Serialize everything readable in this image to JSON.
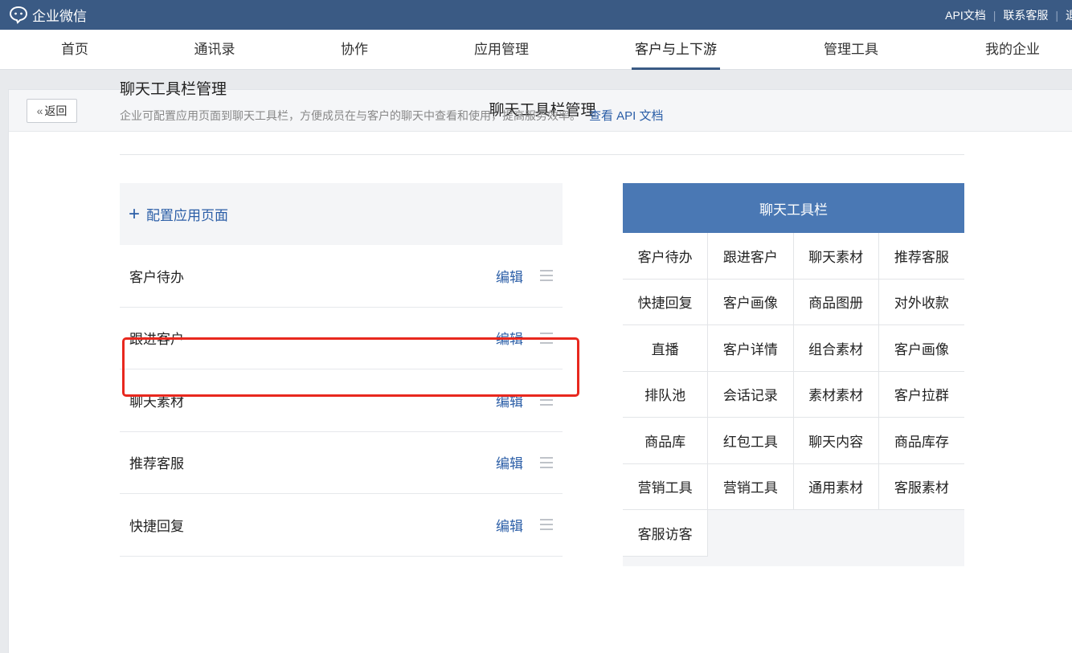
{
  "app": {
    "title": "企业微信"
  },
  "top_links": [
    "API文档",
    "联系客服",
    "退"
  ],
  "nav": [
    {
      "label": "首页"
    },
    {
      "label": "通讯录"
    },
    {
      "label": "协作"
    },
    {
      "label": "应用管理"
    },
    {
      "label": "客户与上下游",
      "active": true
    },
    {
      "label": "管理工具"
    },
    {
      "label": "我的企业"
    }
  ],
  "header": {
    "back_label": "返回",
    "title": "聊天工具栏管理"
  },
  "section": {
    "title": "聊天工具栏管理",
    "description": "企业可配置应用页面到聊天工具栏，方便成员在与客户的聊天中查看和使用，提高服务效率。",
    "api_link": "查看 API 文档"
  },
  "add_label": "配置应用页面",
  "items": [
    {
      "label": "客户待办",
      "edit": "编辑"
    },
    {
      "label": "跟进客户",
      "edit": "编辑"
    },
    {
      "label": "聊天素材",
      "edit": "编辑"
    },
    {
      "label": "推荐客服",
      "edit": "编辑"
    },
    {
      "label": "快捷回复",
      "edit": "编辑"
    }
  ],
  "toolbar": {
    "title": "聊天工具栏",
    "cells": [
      "客户待办",
      "跟进客户",
      "聊天素材",
      "推荐客服",
      "快捷回复",
      "客户画像",
      "商品图册",
      "对外收款",
      "直播",
      "客户详情",
      "组合素材",
      "客户画像",
      "排队池",
      "会话记录",
      "素材素材",
      "客户拉群",
      "商品库",
      "红包工具",
      "聊天内容",
      "商品库存",
      "营销工具",
      "营销工具",
      "通用素材",
      "客服素材",
      "客服访客"
    ]
  },
  "colors": {
    "topbar": "#3a5a84",
    "link": "#2b5ea7",
    "toolbar_head": "#4a78b4",
    "highlight": "#e8281e"
  },
  "icons": {
    "logo": "chat-bubble-icon",
    "back": "double-chevron-left-icon",
    "add": "plus-icon",
    "drag": "drag-handle-icon"
  }
}
